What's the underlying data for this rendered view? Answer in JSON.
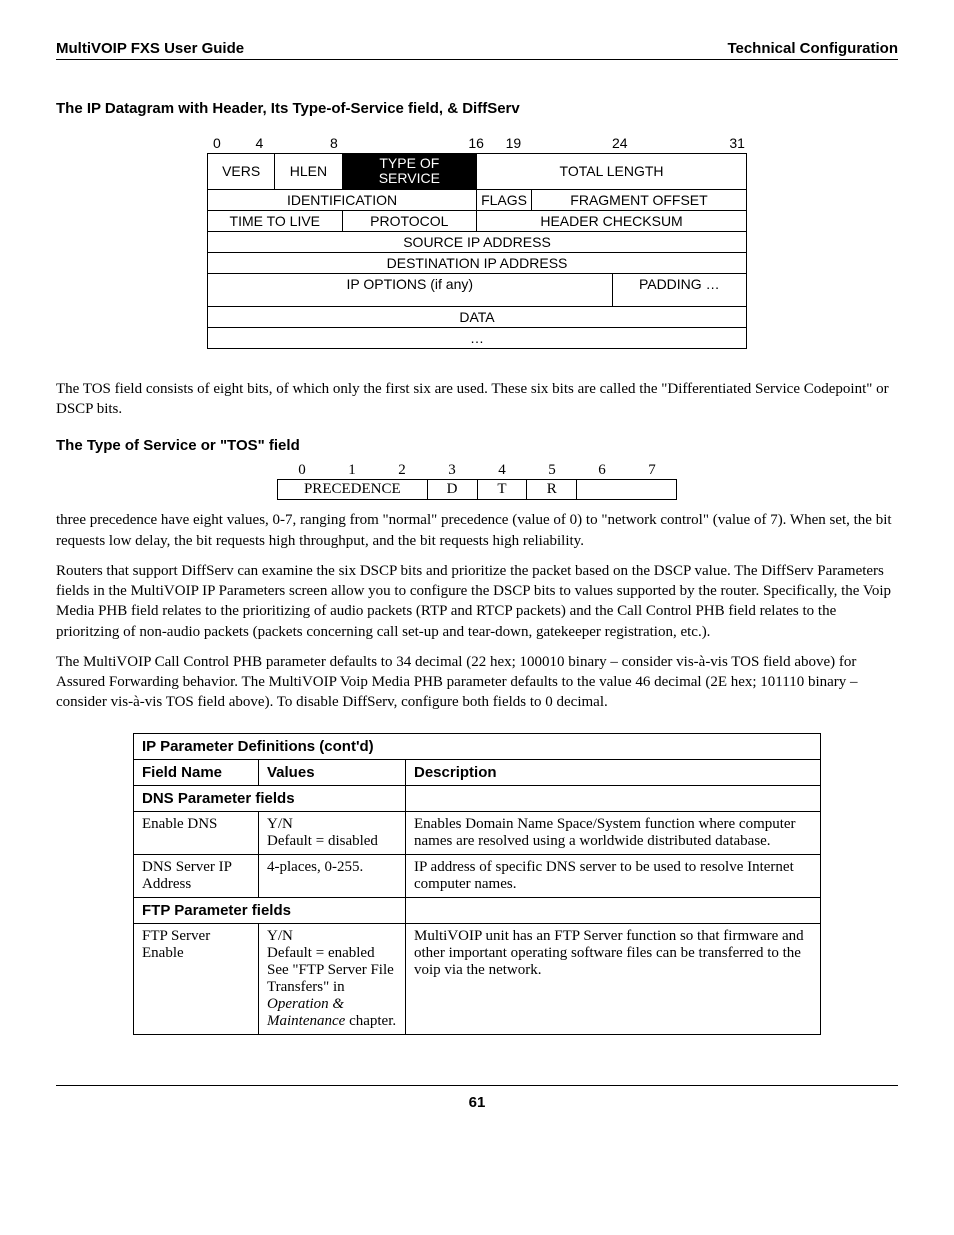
{
  "header": {
    "left": "MultiVOIP FXS User Guide",
    "right": "Technical Configuration"
  },
  "section_title": "The IP Datagram with Header, Its Type-of-Service field, & DiffServ",
  "bit_labels": [
    "0",
    "4",
    "8",
    "16",
    "19",
    "24",
    "31"
  ],
  "ipd": {
    "vers": "VERS",
    "hlen": "HLEN",
    "tos1": "TYPE OF",
    "tos2": "SERVICE",
    "total_len": "TOTAL LENGTH",
    "ident": "IDENTIFICATION",
    "flags": "FLAGS",
    "frag": "FRAGMENT OFFSET",
    "ttl": "TIME TO LIVE",
    "proto": "PROTOCOL",
    "hchk": "HEADER CHECKSUM",
    "src": "SOURCE IP ADDRESS",
    "dst": "DESTINATION IP ADDRESS",
    "opts": "IP OPTIONS (if any)",
    "pad": "PADDING …",
    "data": "DATA",
    "ell": "…"
  },
  "para_tos_intro": "The TOS field consists of eight bits, of which only the first six are used.  These six bits are called the \"Differentiated Service Codepoint\" or DSCP bits.",
  "tos_heading": "The Type of Service or \"TOS\" field",
  "tos_bits": [
    "0",
    "1",
    "2",
    "3",
    "4",
    "5",
    "6",
    "7"
  ],
  "tos_row": {
    "prec": "PRECEDENCE",
    "d": "D",
    "t": "T",
    "r": "R",
    "blank": " "
  },
  "para_prec": "three precedence have eight values, 0-7, ranging from \"normal\" precedence (value of 0) to \"network control\" (value of 7).  When set, the     bit requests low delay, the     bit requests high throughput, and the     bit requests high reliability.",
  "para_diffserv": "Routers that support DiffServ can examine the six DSCP bits and prioritize the packet based on the DSCP value.  The DiffServ Parameters fields in the MultiVOIP IP Parameters screen allow you to configure the DSCP bits to values supported by the router.  Specifically, the Voip Media PHB field relates to the prioritizing of audio packets (RTP and RTCP packets) and the Call Control PHB field relates to the prioritzing of non-audio packets (packets concerning call set-up and tear-down, gatekeeper registration, etc.).",
  "para_phb": "The MultiVOIP Call Control PHB parameter defaults to 34 decimal (22 hex; 100010 binary – consider vis-à-vis TOS field above) for Assured Forwarding behavior.  The MultiVOIP Voip Media PHB parameter defaults to the value 46 decimal (2E hex; 101110 binary – consider vis-à-vis TOS field above).  To disable DiffServ, configure both fields to 0 decimal.",
  "defs": {
    "title": "IP Parameter Definitions (cont'd)",
    "cols": {
      "field": "Field Name",
      "values": "Values",
      "desc": "Description"
    },
    "dns_group": "DNS Parameter fields",
    "rows_dns": [
      {
        "f": "Enable DNS",
        "v1": "Y/N",
        "v2": "Default = disabled",
        "d": "Enables Domain Name Space/System function where computer names are resolved using a worldwide distributed database."
      },
      {
        "f": "DNS Server IP Address",
        "v1": "4-places, 0-255.",
        "d": "IP address of specific DNS server to be used to resolve Internet computer names."
      }
    ],
    "ftp_group": "FTP Parameter fields",
    "rows_ftp": [
      {
        "f": "FTP Server Enable",
        "v1": "Y/N",
        "v2": "Default = enabled",
        "v3a": "See \"FTP Server File Transfers\" in ",
        "v3b": "Operation & Maintenance",
        "v3c": " chapter.",
        "d": "MultiVOIP unit has an FTP Server function so that firmware and other important operating software files can be transferred to the voip via the network."
      }
    ]
  },
  "page_number": "61"
}
